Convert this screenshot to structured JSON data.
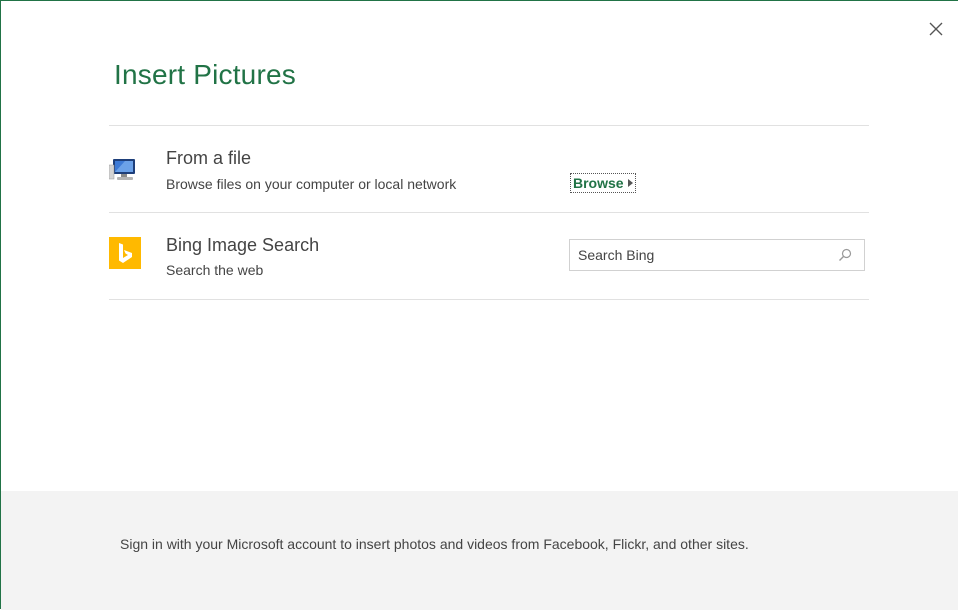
{
  "dialog": {
    "title": "Insert Pictures",
    "accent_color": "#217346"
  },
  "sources": [
    {
      "title": "From a file",
      "description": "Browse files on your computer or local network",
      "icon": "computer-icon",
      "action_label": "Browse"
    },
    {
      "title": "Bing Image Search",
      "description": "Search the web",
      "icon": "bing-icon",
      "search_placeholder": "Search Bing",
      "bing_color": "#ffb900"
    }
  ],
  "footer": {
    "text": "Sign in with your Microsoft account to insert photos and videos from Facebook, Flickr, and other sites."
  }
}
